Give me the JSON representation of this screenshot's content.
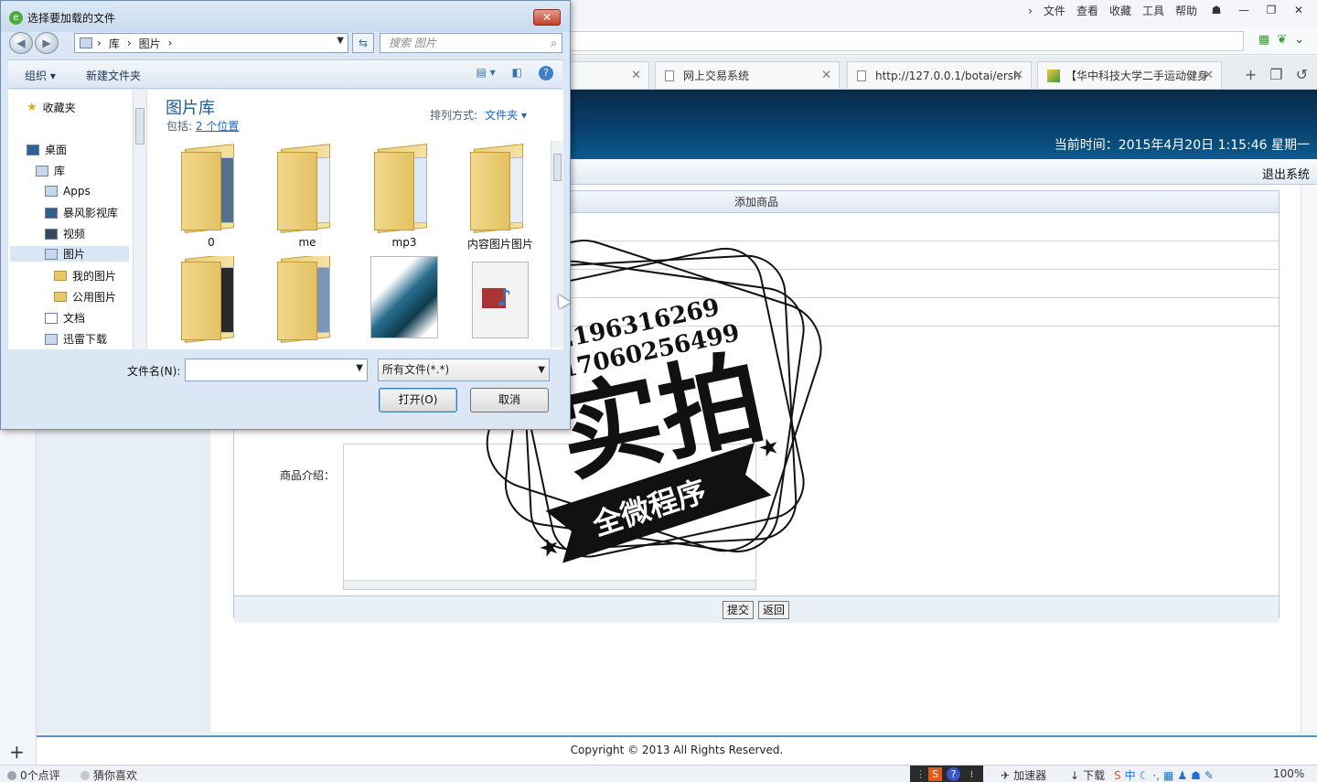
{
  "browser": {
    "menu": [
      "文件",
      "查看",
      "收藏",
      "工具",
      "帮助"
    ],
    "window_buttons": [
      "minimize",
      "restore",
      "close"
    ],
    "tabs": [
      {
        "label": "网上交易系统"
      },
      {
        "label": "http://127.0.0.1/botai/ersh"
      },
      {
        "label": "【华中科技大学二手运动健身"
      }
    ]
  },
  "page": {
    "banner_time": "当前时间：2015年4月20日 1:15:46 星期一",
    "logout": "退出系统",
    "form_title": "添加商品",
    "intro_label": "商品介绍：",
    "submit": "提交",
    "back": "返回",
    "footer": "Copyright © 2013 All Rights Reserved."
  },
  "status": {
    "reviews": "0个点评",
    "guess": "猜你喜欢",
    "accelerator": "加速器",
    "download": "下载",
    "zoom": "100%"
  },
  "watermark": {
    "line1": "Q2196316269",
    "line2": "V17060256499",
    "main": "实拍",
    "ribbon": "全微程序"
  },
  "dialog": {
    "title": "选择要加载的文件",
    "breadcrumb": [
      "库",
      "图片"
    ],
    "search_placeholder": "搜索 图片",
    "toolbar": {
      "organize": "组织",
      "new_folder": "新建文件夹"
    },
    "tree": [
      {
        "label": "收藏夹",
        "icon": "star-icon"
      },
      {
        "label": "桌面",
        "icon": "desktop-icon"
      },
      {
        "label": "库",
        "icon": "library-icon"
      },
      {
        "label": "Apps",
        "icon": "apps-icon"
      },
      {
        "label": "暴风影视库",
        "icon": "video-library-icon"
      },
      {
        "label": "视频",
        "icon": "video-icon"
      },
      {
        "label": "图片",
        "icon": "pictures-icon"
      },
      {
        "label": "我的图片",
        "icon": "folder-icon"
      },
      {
        "label": "公用图片",
        "icon": "folder-icon"
      },
      {
        "label": "文档",
        "icon": "documents-icon"
      },
      {
        "label": "迅雷下载",
        "icon": "download-folder-icon"
      }
    ],
    "library_title": "图片库",
    "includes_label": "包括:",
    "includes_link": "2 个位置",
    "sort_label": "排列方式:",
    "sort_value": "文件夹",
    "items": [
      {
        "label": "0"
      },
      {
        "label": "me"
      },
      {
        "label": "mp3"
      },
      {
        "label": "内容图片图片"
      }
    ],
    "filename_label": "文件名(N):",
    "filename_value": "",
    "filter": "所有文件(*.*)",
    "open": "打开(O)",
    "cancel": "取消"
  }
}
